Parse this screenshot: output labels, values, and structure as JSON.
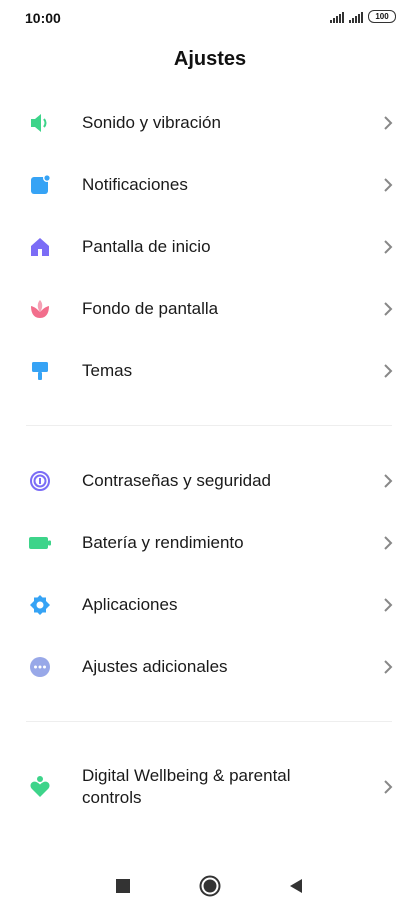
{
  "status_bar": {
    "time": "10:00",
    "battery": "100",
    "signal_icons": [
      "signal-icon",
      "signal-icon"
    ]
  },
  "header": {
    "title": "Ajustes"
  },
  "settings": {
    "group1": [
      {
        "label": "Sonido y vibración",
        "icon": "speaker-icon",
        "color": "#3DD48A"
      },
      {
        "label": "Notificaciones",
        "icon": "notification-icon",
        "color": "#36A3F5"
      },
      {
        "label": "Pantalla de inicio",
        "icon": "home-icon",
        "color": "#7B6CF6"
      },
      {
        "label": "Fondo de pantalla",
        "icon": "flower-icon",
        "color": "#F26E8C"
      },
      {
        "label": "Temas",
        "icon": "brush-icon",
        "color": "#36A3F5"
      }
    ],
    "group2": [
      {
        "label": "Contraseñas y seguridad",
        "icon": "fingerprint-icon",
        "color": "#7B6CF6"
      },
      {
        "label": "Batería y rendimiento",
        "icon": "battery-icon",
        "color": "#3DD48A"
      },
      {
        "label": "Aplicaciones",
        "icon": "gear-icon",
        "color": "#36A3F5"
      },
      {
        "label": "Ajustes adicionales",
        "icon": "more-icon",
        "color": "#98A8E8"
      }
    ],
    "group3": [
      {
        "label": "Digital Wellbeing & parental controls",
        "icon": "wellbeing-icon",
        "color": "#3DD48A"
      }
    ]
  },
  "nav_bar": {
    "items": [
      "recents-icon",
      "home-button-icon",
      "back-icon"
    ]
  }
}
